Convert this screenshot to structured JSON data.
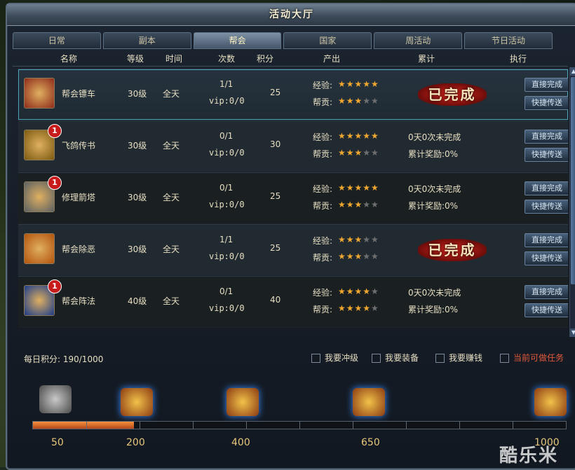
{
  "window": {
    "title": "活动大厅"
  },
  "tabs": [
    "日常",
    "副本",
    "帮会",
    "国家",
    "周活动",
    "节日活动"
  ],
  "active_tab": "帮会",
  "columns": [
    "名称",
    "等级",
    "时间",
    "次数",
    "积分",
    "产出",
    "累计",
    "执行"
  ],
  "labels": {
    "exp": "经验:",
    "contrib": "帮贡:",
    "direct_done": "直接完成",
    "quick_send": "快捷传送",
    "done": "已完成"
  },
  "rows": [
    {
      "name": "帮会镖车",
      "level": "30级",
      "time": "全天",
      "count": "1/1",
      "vip": "vip:0/0",
      "points": "25",
      "exp_stars": 5,
      "contrib_stars": 3,
      "completed": true,
      "badge": ""
    },
    {
      "name": "飞鸽传书",
      "level": "30级",
      "time": "全天",
      "count": "0/1",
      "vip": "vip:0/0",
      "points": "30",
      "exp_stars": 5,
      "contrib_stars": 3,
      "completed": false,
      "progress": "0天0次未完成",
      "reward": "累计奖励:0%",
      "badge": "1"
    },
    {
      "name": "修理箭塔",
      "level": "30级",
      "time": "全天",
      "count": "0/1",
      "vip": "vip:0/0",
      "points": "25",
      "exp_stars": 5,
      "contrib_stars": 3,
      "completed": false,
      "progress": "0天0次未完成",
      "reward": "累计奖励:0%",
      "badge": "1"
    },
    {
      "name": "帮会除恶",
      "level": "30级",
      "time": "全天",
      "count": "1/1",
      "vip": "vip:0/0",
      "points": "25",
      "exp_stars": 3,
      "contrib_stars": 3,
      "completed": true,
      "badge": ""
    },
    {
      "name": "帮会阵法",
      "level": "40级",
      "time": "全天",
      "count": "0/1",
      "vip": "vip:0/0",
      "points": "40",
      "exp_stars": 4,
      "contrib_stars": 4,
      "completed": false,
      "progress": "0天0次未完成",
      "reward": "累计奖励:0%",
      "badge": "1"
    }
  ],
  "footer": {
    "daily_points": "每日积分: 190/1000",
    "filters": [
      "我要冲级",
      "我要装备",
      "我要赚钱",
      "当前可做任务"
    ],
    "milestones": [
      "50",
      "200",
      "400",
      "650",
      "1000"
    ],
    "progress_fraction": 0.19
  },
  "watermark": "酷乐米",
  "colors": {
    "accent": "#4aa6b8",
    "star": "#f0a830",
    "done_red": "#b71d18",
    "bar_fill": "#f5903c",
    "highlight_text": "#e25a3c"
  }
}
